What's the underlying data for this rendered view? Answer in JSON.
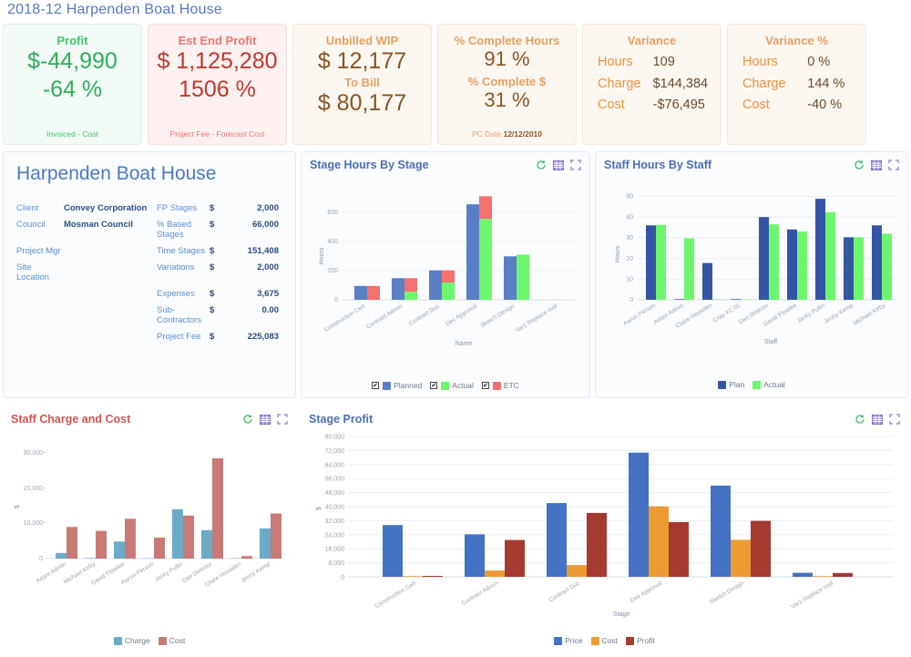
{
  "header": {
    "title": "2018-12 Harpenden Boat House"
  },
  "kpis": [
    {
      "name": "profit",
      "title": "Profit",
      "value": "$-44,990",
      "value2": "-64 %",
      "footer": "Invoiced - Cost"
    },
    {
      "name": "est-end-profit",
      "title": "Est End Profit",
      "value": "$ 1,125,280",
      "value2": "1506 %",
      "footer": "Project Fee - Forecast Cost"
    },
    {
      "name": "unbilled-wip",
      "title": "Unbilled WIP",
      "value": "$ 12,177",
      "label2": "To Bill",
      "value2": "$ 80,177"
    },
    {
      "name": "percent-complete",
      "title": "% Complete Hours",
      "value": "91 %",
      "label2": "% Complete $",
      "value2": "31 %",
      "footer_label": "PC Date",
      "footer_value": "12/12/2010"
    },
    {
      "name": "variance",
      "title": "Variance",
      "rows": [
        {
          "label": "Hours",
          "value": "109"
        },
        {
          "label": "Charge",
          "value": "$144,384"
        },
        {
          "label": "Cost",
          "value": "-$76,495"
        }
      ]
    },
    {
      "name": "variance-percent",
      "title": "Variance %",
      "rows": [
        {
          "label": "Hours",
          "value": "0 %"
        },
        {
          "label": "Charge",
          "value": "144 %"
        },
        {
          "label": "Cost",
          "value": "-40 %"
        }
      ]
    }
  ],
  "project": {
    "title": "Harpenden Boat House",
    "left_rows": [
      {
        "label": "Client",
        "value": "Convey Corporation"
      },
      {
        "label": "Council",
        "value": "Mosman Council"
      },
      {
        "label": "Project Mgr",
        "value": ""
      },
      {
        "label": "Site Location",
        "value": ""
      }
    ],
    "right_rows": [
      {
        "label": "FP Stages",
        "cur": "$",
        "value": "2,000"
      },
      {
        "label": "% Based Stages",
        "cur": "$",
        "value": "66,000"
      },
      {
        "label": "Time Stages",
        "cur": "$",
        "value": "151,408"
      },
      {
        "label": "Variations",
        "cur": "$",
        "value": "2,000"
      },
      {
        "label": "Expenses",
        "cur": "$",
        "value": "3,675"
      },
      {
        "label": "Sub-Contractors",
        "cur": "$",
        "value": "0.00"
      },
      {
        "label": "Project Fee",
        "cur": "$",
        "value": "225,083"
      }
    ]
  },
  "panels": {
    "stage_hours": {
      "title": "Stage Hours By Stage"
    },
    "staff_hours": {
      "title": "Staff Hours By Staff"
    },
    "staff_charge_cost": {
      "title": "Staff Charge and Cost"
    },
    "stage_profit": {
      "title": "Stage Profit"
    }
  },
  "icons": {
    "refresh": "refresh-icon",
    "table": "table-view-icon",
    "fullscreen": "fullscreen-icon"
  },
  "chart_data": [
    {
      "id": "stage_hours",
      "type": "bar",
      "title": "Stage Hours By Stage",
      "xlabel": "Name",
      "ylabel": "Hours",
      "ylim": [
        0,
        720
      ],
      "yticks": [
        0,
        200,
        400,
        600
      ],
      "grid": true,
      "legend_position": "bottom",
      "stacked_note": "Planned bar; Actual bar with ETC stacked above",
      "categories": [
        "Construction Cert",
        "Contract Admin",
        "Contract Doc",
        "Dev Approval",
        "Sketch Design",
        "Var1 Replace roof"
      ],
      "series": [
        {
          "name": "Planned",
          "color": "#5b7fc4",
          "checked": true,
          "values": [
            95,
            148,
            202,
            655,
            298,
            0
          ]
        },
        {
          "name": "Actual",
          "color": "#6ef56e",
          "checked": true,
          "values": [
            0,
            55,
            118,
            555,
            310,
            0
          ]
        },
        {
          "name": "ETC",
          "color": "#f4716f",
          "checked": true,
          "values": [
            95,
            93,
            84,
            155,
            0,
            0
          ]
        }
      ]
    },
    {
      "id": "staff_hours",
      "type": "bar",
      "title": "Staff Hours By Staff",
      "xlabel": "Staff",
      "ylabel": "Hours",
      "ylim": [
        0,
        52
      ],
      "yticks": [
        0,
        10,
        20,
        30,
        40,
        50
      ],
      "grid": true,
      "legend_position": "bottom",
      "categories": [
        "Aaron Person",
        "Adam Admin",
        "Claire Housden",
        "Cray XC 01",
        "Dan Director",
        "David Flowlee",
        "Jacky Pullin",
        "Jenny Kemp",
        "Michael Kirby"
      ],
      "series": [
        {
          "name": "Plan",
          "color": "#3455a4",
          "values": [
            36,
            0.3,
            17.8,
            0.3,
            40,
            34,
            48.8,
            30.2,
            36
          ]
        },
        {
          "name": "Actual",
          "color": "#6ef56e",
          "values": [
            36.2,
            29.7,
            0.2,
            0.2,
            36.5,
            33,
            42.3,
            30.2,
            32
          ]
        }
      ]
    },
    {
      "id": "staff_charge_cost",
      "type": "bar",
      "title": "Staff Charge and Cost",
      "xlabel": "",
      "ylabel": "$",
      "ylim": [
        0,
        31000
      ],
      "yticks": [
        0,
        10000,
        20000,
        30000
      ],
      "ytick_labels": [
        "0",
        "10,000",
        "20,000",
        "30,000"
      ],
      "grid": false,
      "legend_position": "bottom",
      "categories": [
        "Adam Admin",
        "Michael Kirby",
        "David Flowlee",
        "Aaron Person",
        "Jacky Pullin",
        "Dan Director",
        "Claire Housden",
        "Jenny Kemp"
      ],
      "series": [
        {
          "name": "Charge",
          "color": "#6babc8",
          "values": [
            1600,
            150,
            4800,
            120,
            13900,
            8000,
            100,
            8500
          ]
        },
        {
          "name": "Cost",
          "color": "#c97a76",
          "values": [
            8900,
            7800,
            11200,
            5900,
            12100,
            28200,
            700,
            12700
          ]
        }
      ]
    },
    {
      "id": "stage_profit",
      "type": "bar",
      "title": "Stage Profit",
      "xlabel": "Stage",
      "ylabel": "$",
      "ylim": [
        0,
        80000
      ],
      "yticks": [
        0,
        8000,
        16000,
        24000,
        32000,
        40000,
        48000,
        56000,
        64000,
        72000,
        80000
      ],
      "ytick_labels": [
        "0",
        "8,000",
        "16,000",
        "24,000",
        "32,000",
        "40,000",
        "48,000",
        "56,000",
        "64,000",
        "72,000",
        "80,000"
      ],
      "grid": true,
      "legend_position": "bottom",
      "categories": [
        "Construction Cert",
        "Contract Admin",
        "Contract Doc",
        "Dev Approval",
        "Sketch Design",
        "Var1 Replace roof"
      ],
      "series": [
        {
          "name": "Price",
          "color": "#4472c4",
          "values": [
            29500,
            24200,
            42000,
            70800,
            52000,
            2300
          ]
        },
        {
          "name": "Cost",
          "color": "#ed9b33",
          "values": [
            400,
            3600,
            6700,
            40200,
            21100,
            400
          ]
        },
        {
          "name": "Profit",
          "color": "#a53a30",
          "values": [
            500,
            21000,
            36400,
            31200,
            31900,
            2200
          ]
        }
      ]
    }
  ]
}
